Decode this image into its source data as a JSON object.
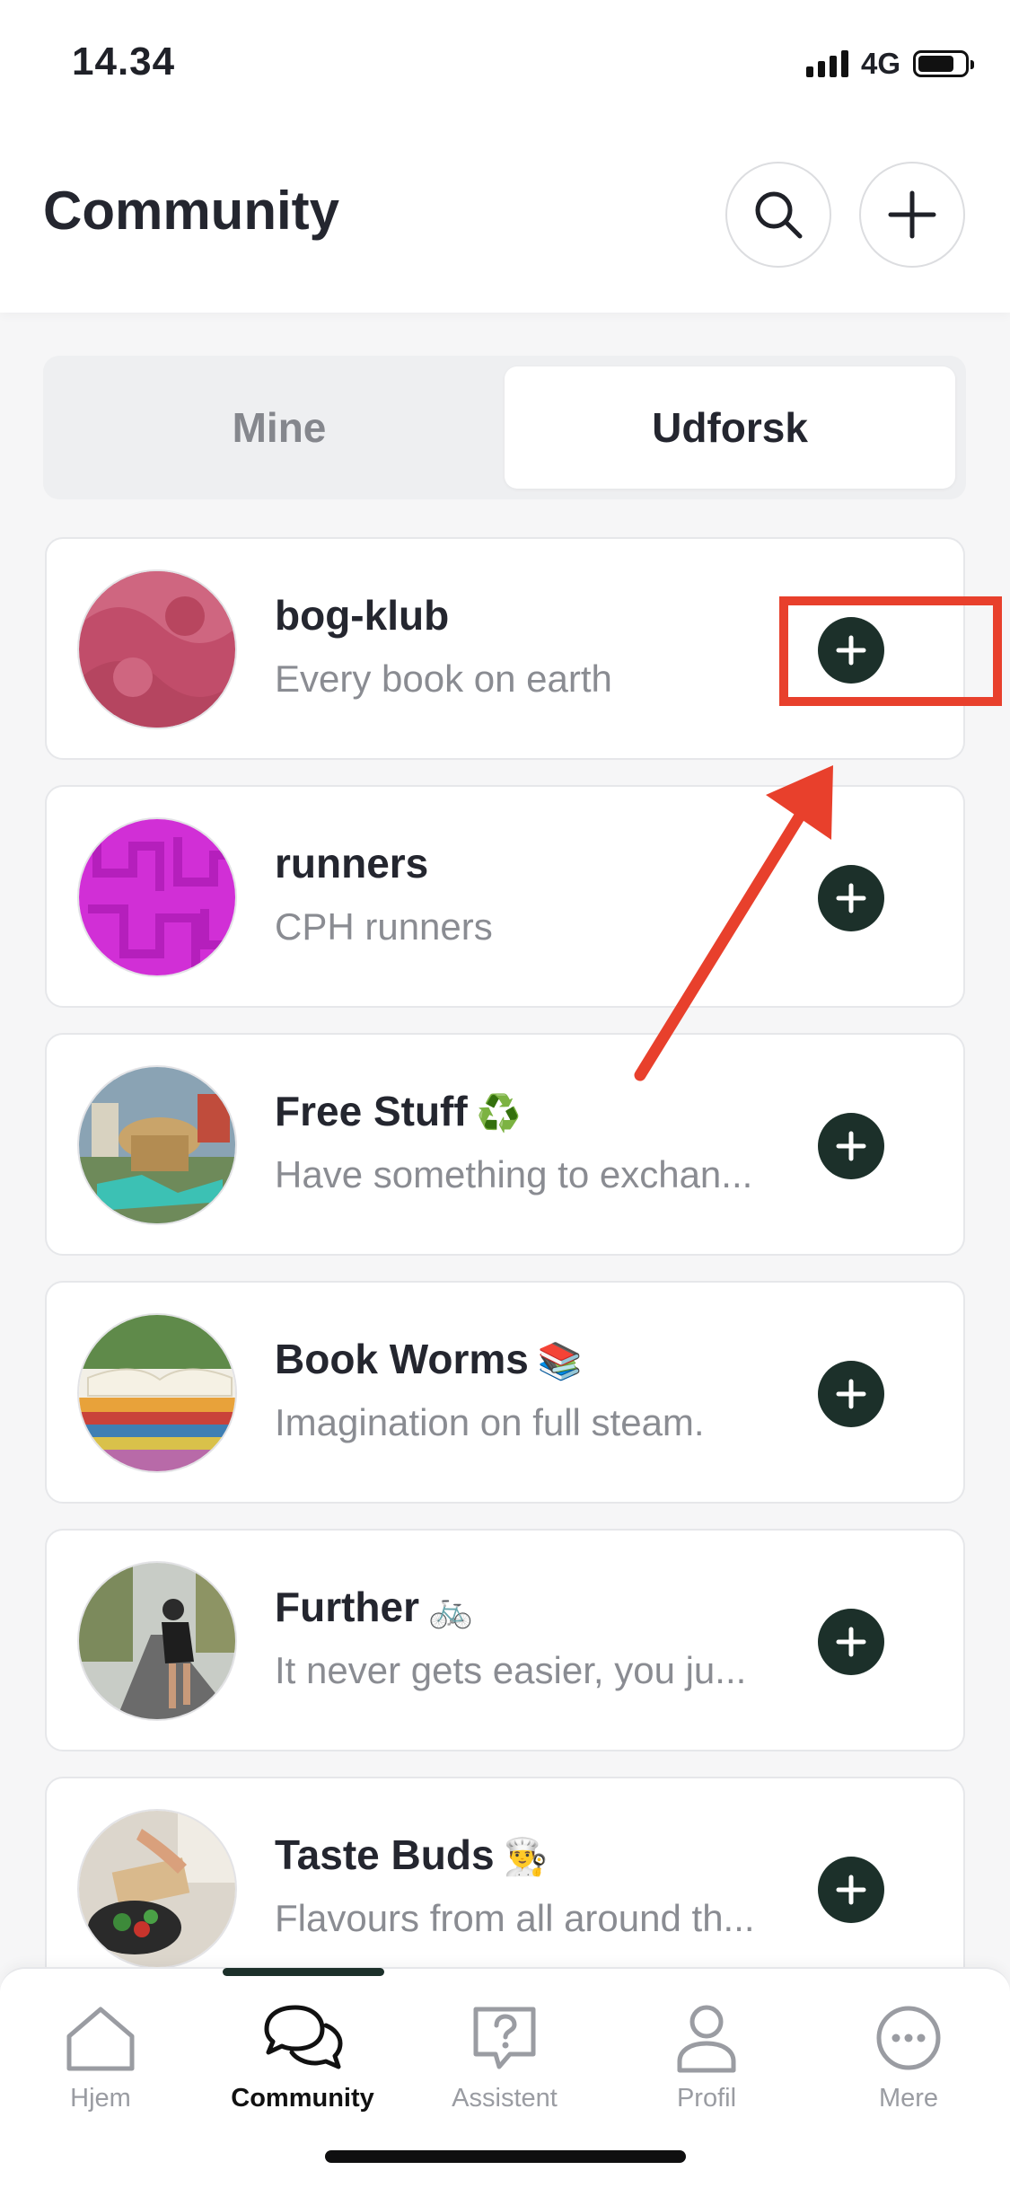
{
  "status_bar": {
    "time": "14.34",
    "network": "4G",
    "battery_level": 0.78
  },
  "header": {
    "title": "Community",
    "icons": [
      "search-icon",
      "plus-icon"
    ]
  },
  "segment": {
    "tabs": [
      "Mine",
      "Udforsk"
    ],
    "selected": "Udforsk"
  },
  "communities": [
    {
      "name": "bog-klub",
      "emoji": "",
      "description": "Every book on earth",
      "avatar": "pink-pattern"
    },
    {
      "name": "runners",
      "emoji": "",
      "description": "CPH runners",
      "avatar": "magenta-pattern"
    },
    {
      "name": "Free Stuff",
      "emoji": "♻️",
      "description": "Have something to exchan...",
      "avatar": "market-photo"
    },
    {
      "name": "Book Worms",
      "emoji": "📚",
      "description": "Imagination on full steam.",
      "avatar": "books-photo"
    },
    {
      "name": "Further",
      "emoji": "🚲",
      "description": "It never gets easier, you ju...",
      "avatar": "cyclist-photo"
    },
    {
      "name": "Taste Buds",
      "emoji": "👨‍🍳",
      "description": "Flavours from all around th...",
      "avatar": "cooking-photo"
    }
  ],
  "bottom_nav": {
    "items": [
      {
        "label": "Hjem",
        "icon": "home-icon"
      },
      {
        "label": "Community",
        "icon": "chat-bubbles-icon"
      },
      {
        "label": "Assistent",
        "icon": "question-bubble-icon"
      },
      {
        "label": "Profil",
        "icon": "person-icon"
      },
      {
        "label": "Mere",
        "icon": "more-icon"
      }
    ],
    "active": "Community"
  },
  "colors": {
    "accent": "#1c302a",
    "annotation": "#e8402c",
    "muted_text": "#8a8c92"
  }
}
